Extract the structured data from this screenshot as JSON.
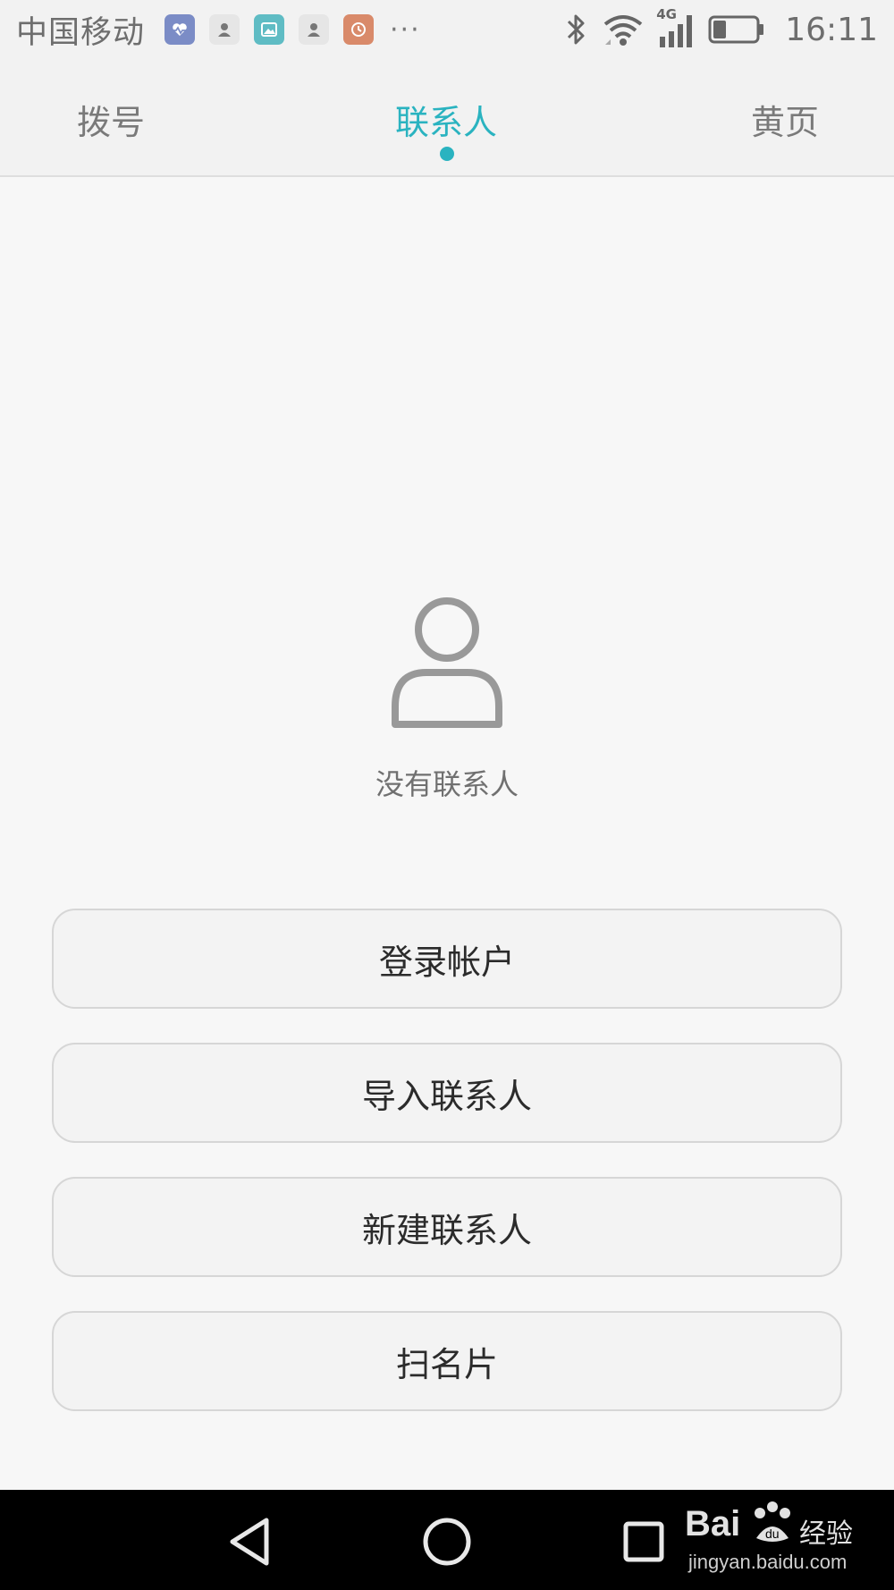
{
  "status_bar": {
    "carrier": "中国移动",
    "more": "···",
    "network": "4G",
    "time": "16:11",
    "icons": [
      "health-app-icon",
      "contacts-app-icon",
      "gallery-app-icon",
      "contacts-app-icon",
      "clock-app-icon",
      "bluetooth-icon",
      "wifi-icon",
      "signal-icon",
      "battery-icon"
    ]
  },
  "tabs": [
    {
      "label": "拨号",
      "active": false
    },
    {
      "label": "联系人",
      "active": true
    },
    {
      "label": "黄页",
      "active": false
    }
  ],
  "empty_state": {
    "icon": "person-icon",
    "message": "没有联系人"
  },
  "actions": [
    {
      "label": "登录帐户"
    },
    {
      "label": "导入联系人"
    },
    {
      "label": "新建联系人"
    },
    {
      "label": "扫名片"
    }
  ],
  "nav": {
    "icons": [
      "back-icon",
      "home-icon",
      "recents-icon"
    ]
  },
  "watermark": {
    "brand": "Bai",
    "brand_suffix": "经验",
    "url": "jingyan.baidu.com"
  },
  "colors": {
    "accent": "#2ab3c0",
    "background": "#f7f7f7",
    "nav_background": "#000000"
  }
}
